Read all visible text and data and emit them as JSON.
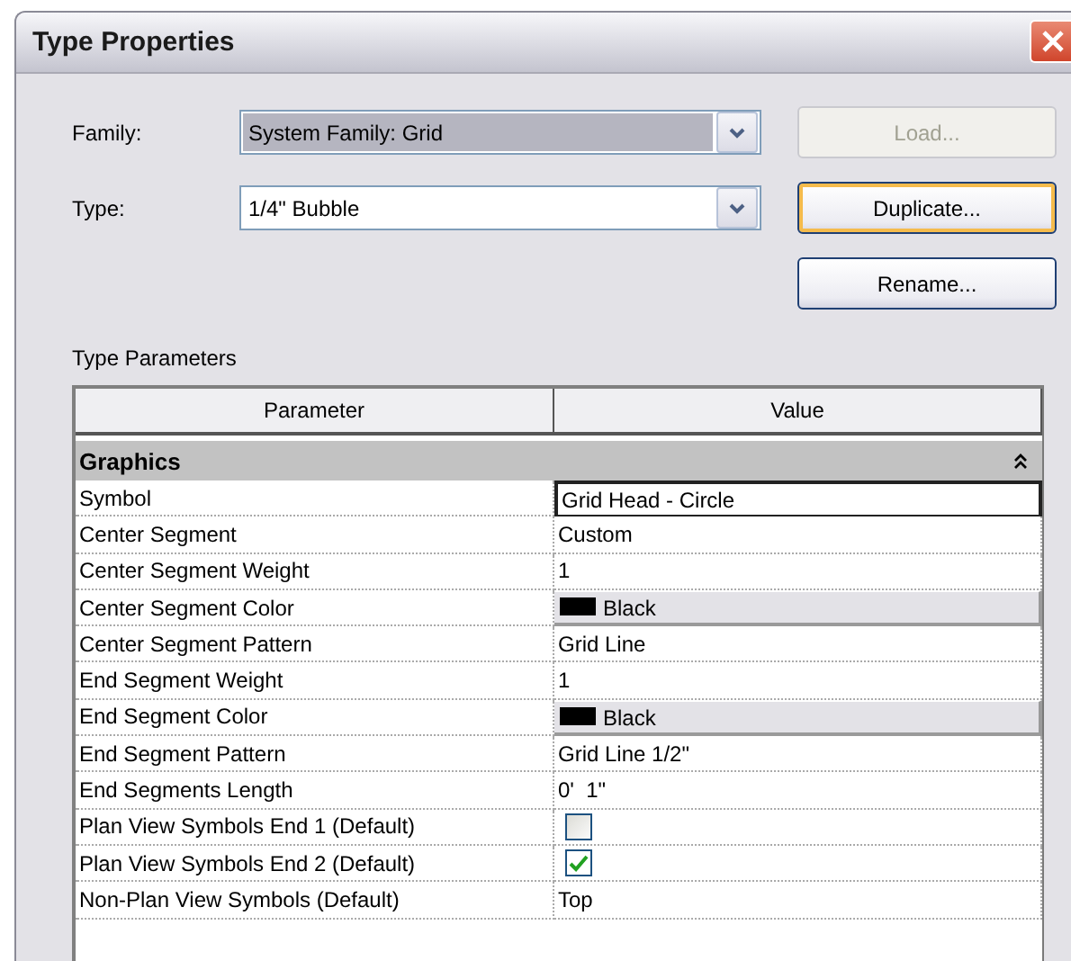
{
  "window": {
    "title": "Type Properties"
  },
  "family": {
    "label": "Family:",
    "value": "System Family: Grid",
    "highlighted": true
  },
  "type": {
    "label": "Type:",
    "value": "1/4\" Bubble",
    "highlighted": false
  },
  "buttons": [
    {
      "label": "Load...",
      "disabled": true,
      "default": false
    },
    {
      "label": "Duplicate...",
      "disabled": false,
      "default": true
    },
    {
      "label": "Rename...",
      "disabled": false,
      "default": false
    }
  ],
  "section_label": "Type Parameters",
  "table": {
    "columns": [
      "Parameter",
      "Value"
    ],
    "groups": [
      {
        "name": "Graphics",
        "expanded": true,
        "rows": [
          {
            "kind": "field",
            "parameter": "Symbol",
            "value": "Grid Head - Circle"
          },
          {
            "kind": "text",
            "parameter": "Center Segment",
            "value": "Custom"
          },
          {
            "kind": "text",
            "parameter": "Center Segment Weight",
            "value": "1"
          },
          {
            "kind": "color",
            "parameter": "Center Segment Color",
            "value": "Black",
            "color": "#000000"
          },
          {
            "kind": "text",
            "parameter": "Center Segment Pattern",
            "value": "Grid Line"
          },
          {
            "kind": "text",
            "parameter": "End Segment Weight",
            "value": "1"
          },
          {
            "kind": "color",
            "parameter": "End Segment Color",
            "value": "Black",
            "color": "#000000"
          },
          {
            "kind": "text",
            "parameter": "End Segment Pattern",
            "value": "Grid Line 1/2\""
          },
          {
            "kind": "text",
            "parameter": "End Segments Length",
            "value": "0'  1\""
          },
          {
            "kind": "checkbox",
            "parameter": "Plan View Symbols End 1 (Default)",
            "checked": false
          },
          {
            "kind": "checkbox",
            "parameter": "Plan View Symbols End 2 (Default)",
            "checked": true
          },
          {
            "kind": "text",
            "parameter": "Non-Plan View Symbols (Default)",
            "value": "Top"
          }
        ]
      }
    ]
  }
}
